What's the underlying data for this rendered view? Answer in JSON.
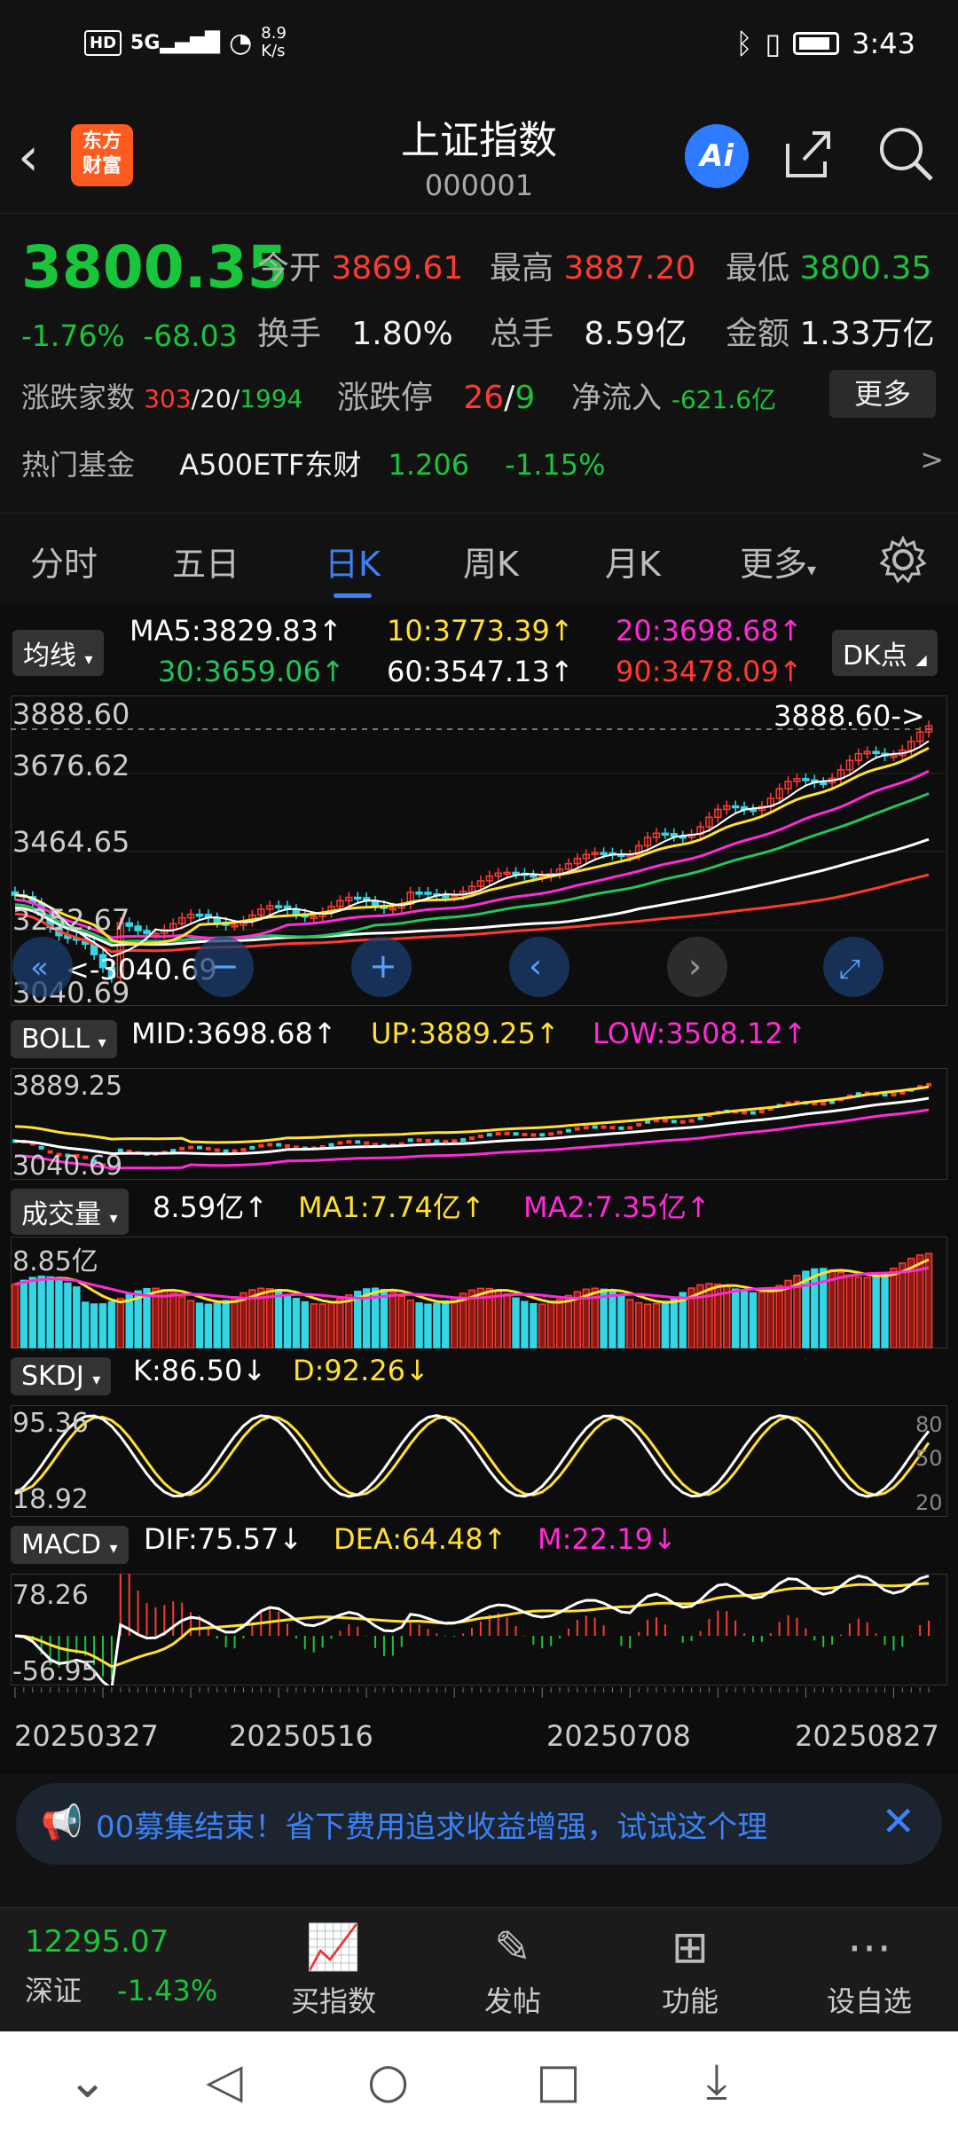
{
  "status_bar": {
    "hd": "HD",
    "signal": "5G",
    "net_speed_value": "8.9",
    "net_speed_unit": "K/s",
    "time": "3:43"
  },
  "header": {
    "logo_text": "东方财富",
    "title": "上证指数",
    "code": "000001",
    "ai_label": "Ai"
  },
  "quote": {
    "price": "3800.35",
    "change_pct": "-1.76%",
    "change_abs": "-68.03",
    "open_label": "今开",
    "open": "3869.61",
    "high_label": "最高",
    "high": "3887.20",
    "low_label": "最低",
    "low": "3800.35",
    "turnover_label": "换手",
    "turnover": "1.80%",
    "volume_label": "总手",
    "volume": "8.59亿",
    "amount_label": "金额",
    "amount": "1.33万亿",
    "breadth_label": "涨跌家数",
    "up": "303",
    "flat": "20",
    "down": "1994",
    "limit_label": "涨跌停",
    "limit_up": "26",
    "limit_down": "9",
    "netflow_label": "净流入",
    "netflow": "-621.6亿",
    "more_label": "更多"
  },
  "hot_fund": {
    "label": "热门基金",
    "name": "A500ETF东财",
    "price": "1.206",
    "change": "-1.15%",
    "arrow": ">"
  },
  "tabs": [
    "分时",
    "五日",
    "日K",
    "周K",
    "月K",
    "更多"
  ],
  "active_tab": "日K",
  "main_chart": {
    "indicator_btn": "均线",
    "dk_btn": "DK点",
    "ma5": "MA5:3829.83↑",
    "ma10": "10:3773.39↑",
    "ma20": "20:3698.68↑",
    "ma30": "30:3659.06↑",
    "ma60": "60:3547.13↑",
    "ma90": "90:3478.09↑",
    "y_labels": [
      "3888.60",
      "3676.62",
      "3464.65",
      "3252.67",
      "3040.69"
    ],
    "max_marker": "3888.60->",
    "min_marker": "<-3040.69"
  },
  "boll": {
    "btn": "BOLL",
    "mid": "MID:3698.68↑",
    "up": "UP:3889.25↑",
    "low": "LOW:3508.12↑",
    "y_labels": [
      "3889.25",
      "3040.69"
    ]
  },
  "volume": {
    "btn": "成交量",
    "val": "8.59亿↑",
    "ma1": "MA1:7.74亿↑",
    "ma2": "MA2:7.35亿↑",
    "y_label": "8.85亿"
  },
  "skdj": {
    "btn": "SKDJ",
    "k": "K:86.50↓",
    "d": "D:92.26↓",
    "y_labels": [
      "95.36",
      "18.92"
    ],
    "right_labels": [
      "80",
      "50",
      "20"
    ]
  },
  "macd": {
    "btn": "MACD",
    "dif": "DIF:75.57↓",
    "dea": "DEA:64.48↑",
    "m": "M:22.19↓",
    "y_labels": [
      "78.26",
      "-56.95"
    ]
  },
  "x_dates": [
    "20250327",
    "20250516",
    "20250708",
    "20250827"
  ],
  "banner": {
    "text": "00募集结束！省下费用追求收益增强，试试这个理"
  },
  "toolbar": {
    "index_value": "12295.07",
    "index_name": "深证",
    "index_change": "-1.43%",
    "buy_label": "买指数",
    "post_label": "发帖",
    "func_label": "功能",
    "watch_label": "设自选"
  },
  "colors": {
    "up": "#ff3b30",
    "down": "#19c53b",
    "accent": "#3b82f6",
    "ma5": "#ffffff",
    "ma10": "#ffe033",
    "ma20": "#ff2bd6",
    "ma30": "#22c55e",
    "ma60": "#ffffff",
    "ma90": "#ff3b30"
  }
}
